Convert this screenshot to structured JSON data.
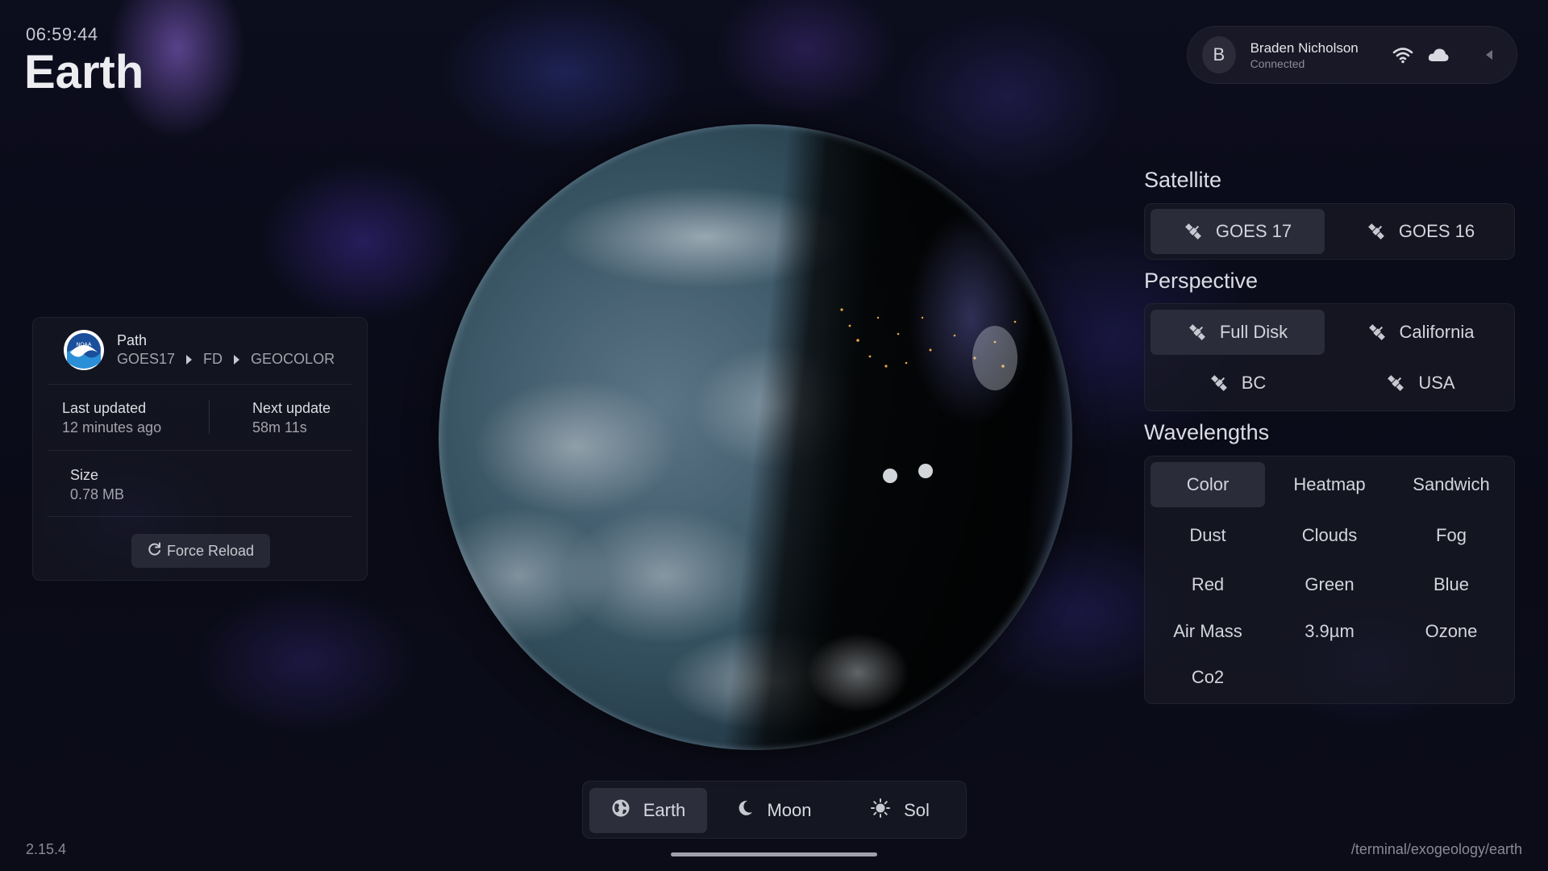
{
  "header": {
    "time": "06:59:44",
    "title": "Earth"
  },
  "user": {
    "initial": "B",
    "name": "Braden Nicholson",
    "status": "Connected",
    "icons": [
      "wifi-icon",
      "cloud-icon",
      "collapse-arrow-icon"
    ]
  },
  "info": {
    "path_label": "Path",
    "path": [
      "GOES17",
      "FD",
      "GEOCOLOR"
    ],
    "last_updated_label": "Last updated",
    "last_updated_value": "12 minutes ago",
    "next_update_label": "Next update",
    "next_update_value": "58m 11s",
    "size_label": "Size",
    "size_value": "0.78 MB",
    "reload_label": "Force Reload",
    "logo_text": "NOAA"
  },
  "satellite": {
    "title": "Satellite",
    "options": [
      "GOES 17",
      "GOES 16"
    ],
    "selected": "GOES 17"
  },
  "perspective": {
    "title": "Perspective",
    "options": [
      "Full Disk",
      "California",
      "BC",
      "USA"
    ],
    "selected": "Full Disk"
  },
  "wavelengths": {
    "title": "Wavelengths",
    "options": [
      "Color",
      "Heatmap",
      "Sandwich",
      "Dust",
      "Clouds",
      "Fog",
      "Red",
      "Green",
      "Blue",
      "Air Mass",
      "3.9µm",
      "Ozone",
      "Co2"
    ],
    "selected": "Color"
  },
  "tabs": {
    "items": [
      "Earth",
      "Moon",
      "Sol"
    ],
    "selected": "Earth"
  },
  "footer": {
    "version": "2.15.4",
    "route": "/terminal/exogeology/earth"
  },
  "colors": {
    "background": "#0a0b16",
    "panel": "#181924",
    "selected": "#2c2d3c",
    "text": "#e6e6ea",
    "muted": "#a2a2ac"
  }
}
